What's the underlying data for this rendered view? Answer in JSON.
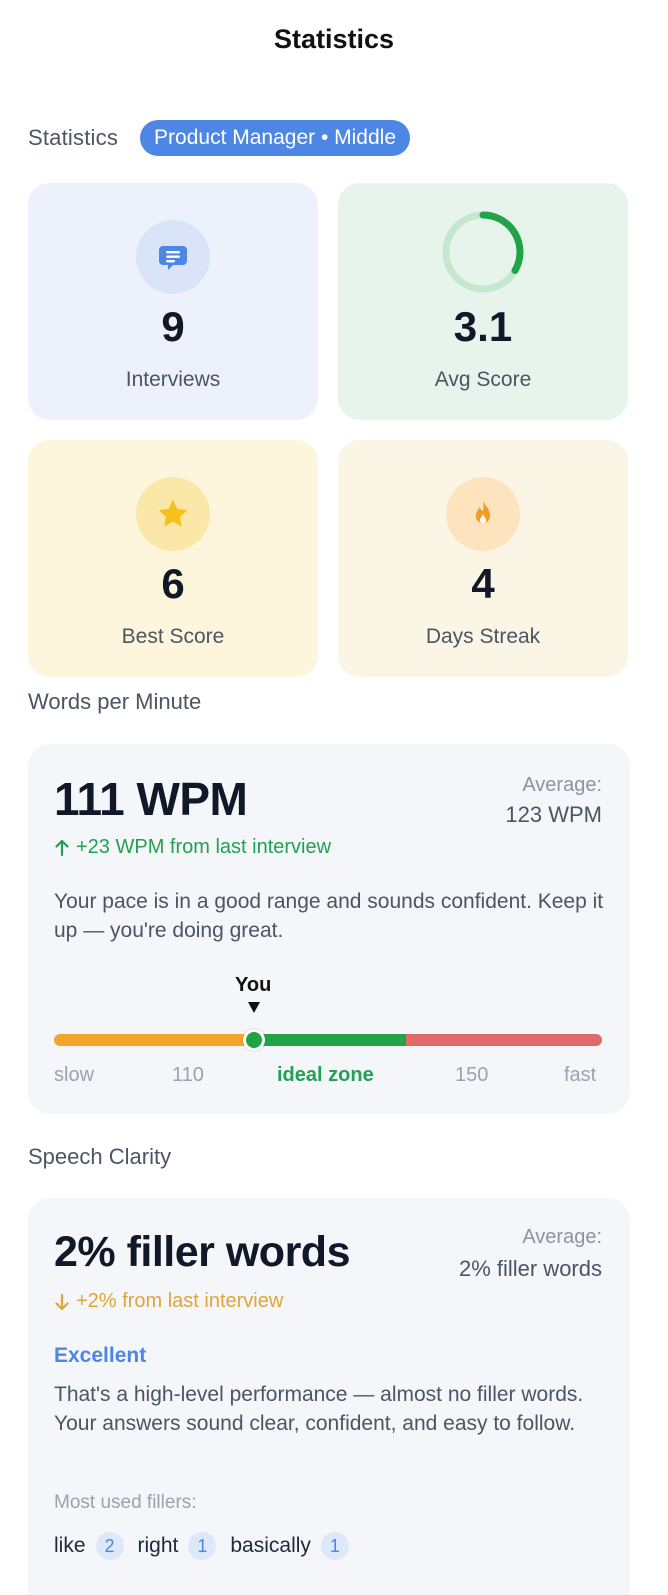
{
  "header": {
    "title": "Statistics"
  },
  "stats_section": {
    "label": "Statistics",
    "role_badge": "Product Manager • Middle"
  },
  "cards": {
    "interviews": {
      "value": "9",
      "label": "Interviews",
      "icon": "chat-bubble-icon",
      "bg": "#ecf1fb"
    },
    "avg_score": {
      "value": "3.1",
      "label": "Avg Score",
      "icon": "progress-ring-icon",
      "bg": "#e7f4ec"
    },
    "best_score": {
      "value": "6",
      "label": "Best Score",
      "icon": "star-icon",
      "bg": "#fdf6dc"
    },
    "streak": {
      "value": "4",
      "label": "Days Streak",
      "icon": "flame-icon",
      "bg": "#fbf5e6"
    }
  },
  "wpm": {
    "heading": "Words per Minute",
    "value": "111 WPM",
    "average_label": "Average:",
    "average_value": "123 WPM",
    "delta": "+23 WPM from last interview",
    "description": "Your pace is in a good range and sounds confident. Keep it up — you're doing great.",
    "you_label": "You",
    "scale": {
      "slow": "slow",
      "low_bound": "110",
      "ideal": "ideal zone",
      "high_bound": "150",
      "fast": "fast"
    },
    "marker_value": 111
  },
  "clarity": {
    "heading": "Speech Clarity",
    "value": "2% filler words",
    "average_label": "Average:",
    "average_value": "2% filler words",
    "delta": "+2% from last interview",
    "rating": "Excellent",
    "description": "That's a high-level performance — almost no filler words. Your answers sound clear, confident, and easy to follow.",
    "fillers_heading": "Most used fillers:",
    "fillers": [
      {
        "word": "like",
        "count": "2"
      },
      {
        "word": "right",
        "count": "1"
      },
      {
        "word": "basically",
        "count": "1"
      }
    ]
  },
  "colors": {
    "accent": "#4d86e4",
    "positive": "#23a052",
    "warning": "#e0a43b",
    "danger": "#e06a6a",
    "slow": "#f4a529"
  }
}
